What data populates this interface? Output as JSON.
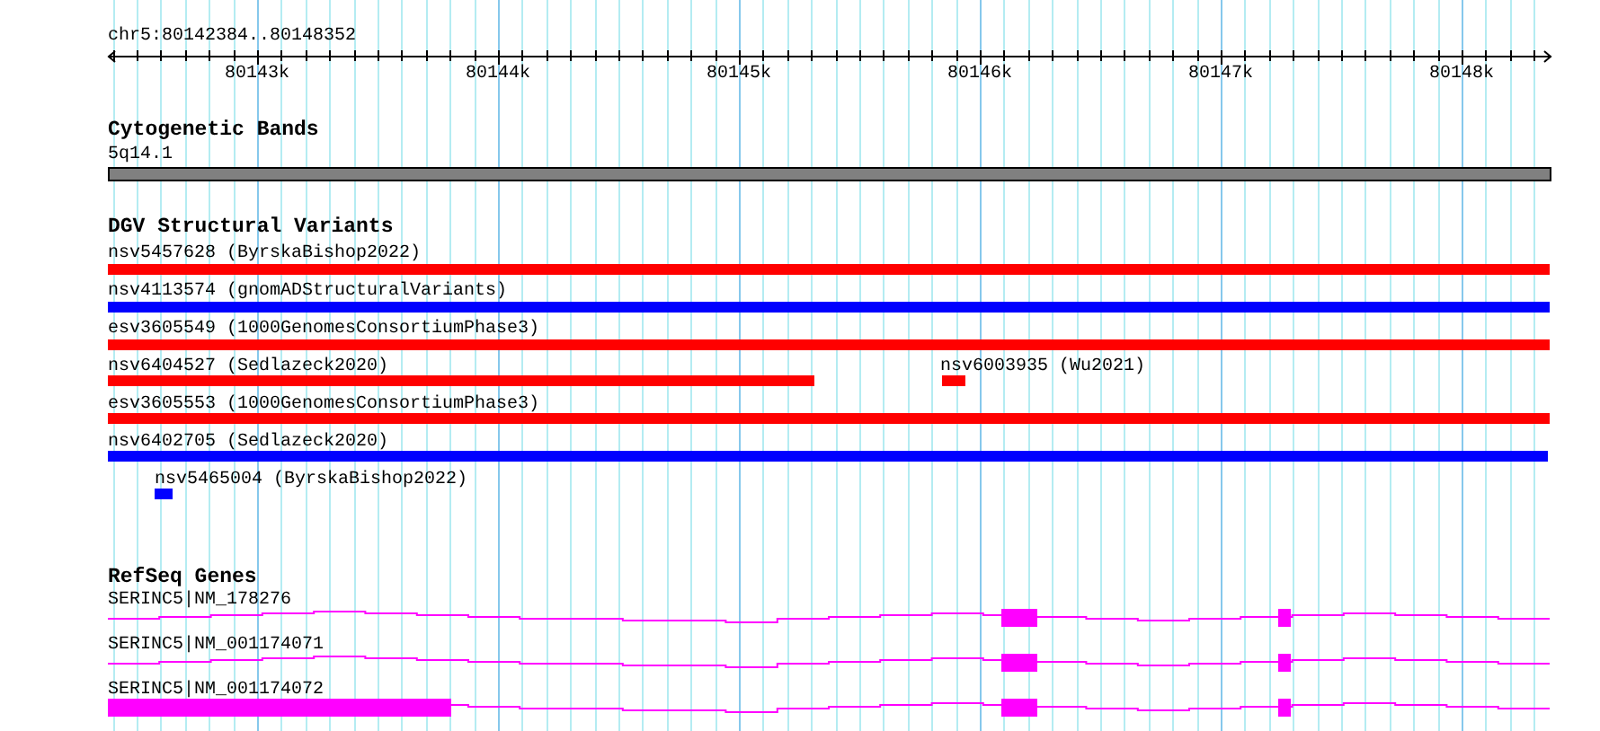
{
  "ruler": {
    "title": "chr5:80142384..80148352",
    "ticks": [
      "80143k",
      "80144k",
      "80145k",
      "80146k",
      "80147k",
      "80148k"
    ]
  },
  "tracks": [
    {
      "title": "Cytogenetic Bands",
      "kind": "band",
      "features": [
        {
          "label": "5q14.1",
          "color": "#808080"
        }
      ]
    },
    {
      "title": "DGV Structural Variants",
      "kind": "variant",
      "rows": [
        [
          {
            "label": "nsv5457628 (ByrskaBishop2022)",
            "color": "#ff0000"
          }
        ],
        [
          {
            "label": "nsv4113574 (gnomADStructuralVariants)",
            "color": "#0000ff"
          }
        ],
        [
          {
            "label": "esv3605549 (1000GenomesConsortiumPhase3)",
            "color": "#ff0000"
          }
        ],
        [
          {
            "label": "nsv6404527 (Sedlazeck2020)",
            "color": "#ff0000"
          },
          {
            "label": "nsv6003935 (Wu2021)",
            "color": "#ff0000"
          }
        ],
        [
          {
            "label": "esv3605553 (1000GenomesConsortiumPhase3)",
            "color": "#ff0000"
          }
        ],
        [
          {
            "label": "nsv6402705 (Sedlazeck2020)",
            "color": "#0000ff"
          }
        ],
        [
          {
            "label": "nsv5465004 (ByrskaBishop2022)",
            "color": "#0000ff"
          }
        ]
      ]
    },
    {
      "title": "RefSeq Genes",
      "kind": "gene",
      "features": [
        {
          "label": "SERINC5|NM_178276",
          "color": "#ff00ff"
        },
        {
          "label": "SERINC5|NM_001174071",
          "color": "#ff00ff"
        },
        {
          "label": "SERINC5|NM_001174072",
          "color": "#ff00ff"
        }
      ]
    }
  ]
}
